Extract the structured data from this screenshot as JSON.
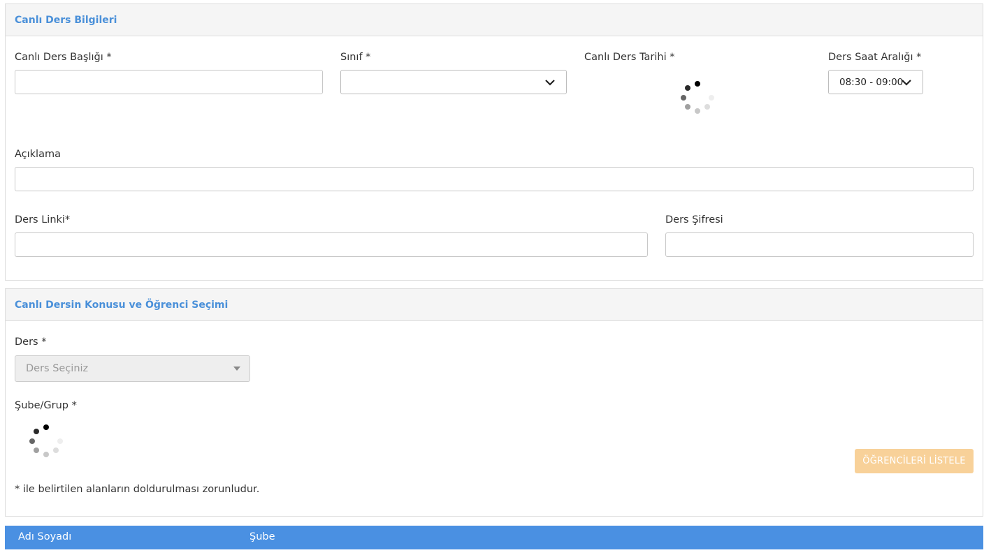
{
  "panel1": {
    "title": "Canlı Ders Bilgileri",
    "lesson_title_label": "Canlı Ders Başlığı *",
    "class_label": "Sınıf *",
    "date_label": "Canlı Ders Tarihi *",
    "time_range_label": "Ders Saat Aralığı *",
    "time_range_value": "08:30 - 09:00",
    "description_label": "Açıklama",
    "link_label": "Ders Linki*",
    "password_label": "Ders Şifresi"
  },
  "panel2": {
    "title": "Canlı Dersin Konusu ve Öğrenci Seçimi",
    "course_label": "Ders *",
    "course_placeholder": "Ders Seçiniz",
    "group_label": "Şube/Grup *",
    "list_button": "ÖĞRENCİLERİ LİSTELE",
    "required_note": "* ile belirtilen alanların doldurulması zorunludur."
  },
  "table": {
    "columns": [
      "Adı Soyadı",
      "Şube"
    ]
  },
  "colors": {
    "accent": "#4a90d9",
    "table_header": "#4a90e2",
    "button_disabled": "#f8d199"
  },
  "icons": {
    "dropdown": "chevron-down-icon",
    "caret": "caret-down-icon",
    "loading": "loading-spinner-icon"
  }
}
